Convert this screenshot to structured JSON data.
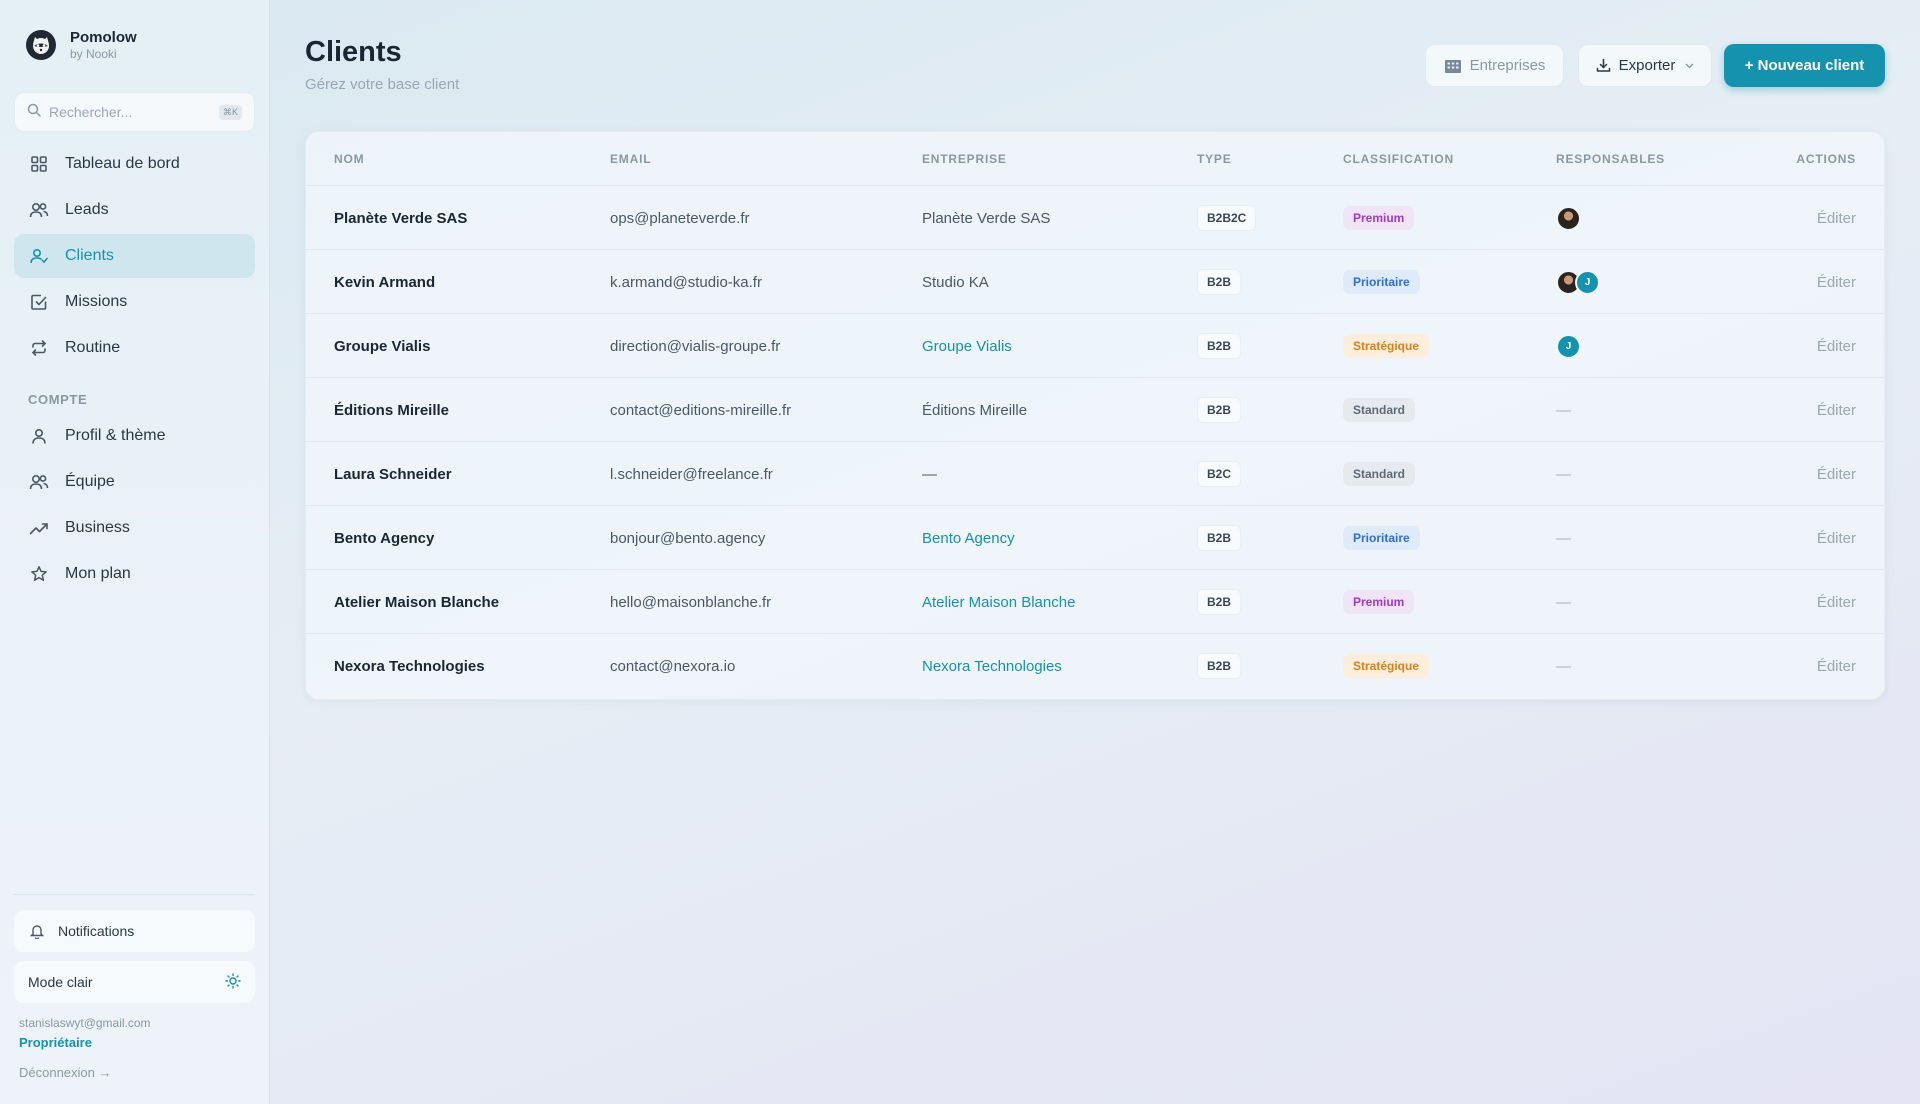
{
  "app": {
    "name": "Pomolow",
    "subtitle": "by Nooki"
  },
  "search": {
    "placeholder": "Rechercher...",
    "shortcut": "⌘K"
  },
  "nav": {
    "items": [
      {
        "label": "Tableau de bord",
        "icon": "grid-icon",
        "active": false
      },
      {
        "label": "Leads",
        "icon": "users-icon",
        "active": false
      },
      {
        "label": "Clients",
        "icon": "user-check-icon",
        "active": true
      },
      {
        "label": "Missions",
        "icon": "checkbox-icon",
        "active": false
      },
      {
        "label": "Routine",
        "icon": "repeat-icon",
        "active": false
      }
    ],
    "section_label": "COMPTE",
    "account_items": [
      {
        "label": "Profil & thème",
        "icon": "user-icon"
      },
      {
        "label": "Équipe",
        "icon": "team-icon"
      },
      {
        "label": "Business",
        "icon": "trending-up-icon"
      },
      {
        "label": "Mon plan",
        "icon": "star-icon"
      }
    ]
  },
  "footer": {
    "notifications": "Notifications",
    "mode": "Mode clair",
    "email": "stanislaswyt@gmail.com",
    "role": "Propriétaire",
    "logout": "Déconnexion →"
  },
  "header": {
    "title": "Clients",
    "subtitle": "Gérez votre base client",
    "btn_entreprises": "Entreprises",
    "btn_exporter": "Exporter",
    "btn_new": "+ Nouveau client"
  },
  "table": {
    "headers": {
      "name": "NOM",
      "email": "EMAIL",
      "entreprise": "ENTREPRISE",
      "type": "TYPE",
      "classification": "CLASSIFICATION",
      "responsables": "RESPONSABLES",
      "actions": "ACTIONS"
    },
    "rows": [
      {
        "name": "Planète Verde SAS",
        "email": "ops@planeteverde.fr",
        "entreprise": "Planète Verde SAS",
        "entreprise_link": false,
        "type": "B2B2C",
        "classification": "Premium",
        "responsables": "photo",
        "action": "Éditer"
      },
      {
        "name": "Kevin Armand",
        "email": "k.armand@studio-ka.fr",
        "entreprise": "Studio KA",
        "entreprise_link": false,
        "type": "B2B",
        "classification": "Prioritaire",
        "responsables": "photo+J",
        "action": "Éditer"
      },
      {
        "name": "Groupe Vialis",
        "email": "direction@vialis-groupe.fr",
        "entreprise": "Groupe Vialis",
        "entreprise_link": true,
        "type": "B2B",
        "classification": "Stratégique",
        "responsables": "J",
        "action": "Éditer"
      },
      {
        "name": "Éditions Mireille",
        "email": "contact@editions-mireille.fr",
        "entreprise": "Éditions Mireille",
        "entreprise_link": false,
        "type": "B2B",
        "classification": "Standard",
        "responsables": "—",
        "action": "Éditer"
      },
      {
        "name": "Laura Schneider",
        "email": "l.schneider@freelance.fr",
        "entreprise": "—",
        "entreprise_link": false,
        "type": "B2C",
        "classification": "Standard",
        "responsables": "—",
        "action": "Éditer"
      },
      {
        "name": "Bento Agency",
        "email": "bonjour@bento.agency",
        "entreprise": "Bento Agency",
        "entreprise_link": true,
        "type": "B2B",
        "classification": "Prioritaire",
        "responsables": "—",
        "action": "Éditer"
      },
      {
        "name": "Atelier Maison Blanche",
        "email": "hello@maisonblanche.fr",
        "entreprise": "Atelier Maison Blanche",
        "entreprise_link": true,
        "type": "B2B",
        "classification": "Premium",
        "responsables": "—",
        "action": "Éditer"
      },
      {
        "name": "Nexora Technologies",
        "email": "contact@nexora.io",
        "entreprise": "Nexora Technologies",
        "entreprise_link": true,
        "type": "B2B",
        "classification": "Stratégique",
        "responsables": "—",
        "action": "Éditer"
      }
    ]
  },
  "colors": {
    "accent": "#1592ad",
    "premium": "#a13ac4",
    "prioritaire": "#2c6fd6",
    "strategique": "#d9811d",
    "standard": "#5d6b78"
  }
}
